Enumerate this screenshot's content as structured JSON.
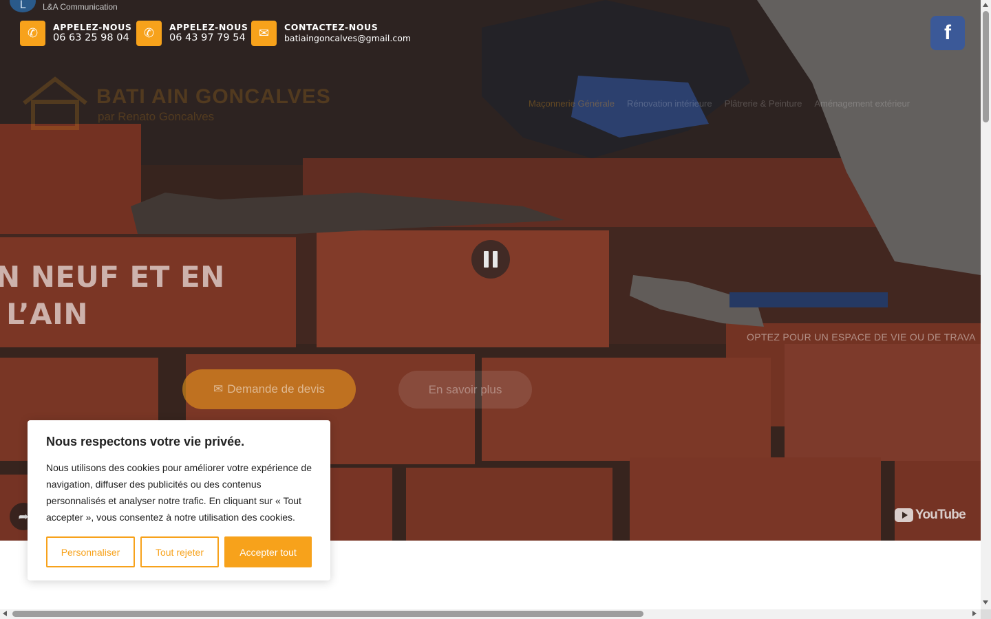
{
  "video": {
    "channel_initial": "L",
    "channel_name": "L&A Communication",
    "platform_label": "YouTube"
  },
  "contacts": [
    {
      "label": "APPELEZ-NOUS",
      "value": "06 63 25 98 04",
      "icon": "phone-icon"
    },
    {
      "label": "APPELEZ-NOUS",
      "value": "06 43 97 79 54",
      "icon": "phone-icon"
    },
    {
      "label": "CONTACTEZ-NOUS",
      "value": "batiaingoncalves@gmail.com",
      "icon": "envelope-icon"
    }
  ],
  "social": {
    "facebook_label": "f"
  },
  "logo": {
    "name": "BATI AIN GONCALVES",
    "subtitle": "par Renato Goncalves"
  },
  "nav": [
    "Maçonnerie Générale",
    "Rénovation intérieure",
    "Plâtrerie & Peinture",
    "Aménagement extérieur"
  ],
  "hero": {
    "headline": "N NEUF ET EN\n L’AIN",
    "tagline": "OPTEZ POUR UN ESPACE DE VIE OU DE TRAVA",
    "devis_button": "Demande de devis",
    "more_button": "En savoir plus"
  },
  "cookie_banner": {
    "title": "Nous respectons votre vie privée.",
    "text": "Nous utilisons des cookies pour améliorer votre expérience de navigation, diffuser des publicités ou des contenus personnalisés et analyser notre trafic. En cliquant sur « Tout accepter », vous consentez à notre utilisation des cookies.",
    "customize": "Personnaliser",
    "reject": "Tout rejeter",
    "accept": "Accepter tout"
  },
  "colors": {
    "accent": "#f7a21b",
    "facebook": "#3b5998"
  }
}
